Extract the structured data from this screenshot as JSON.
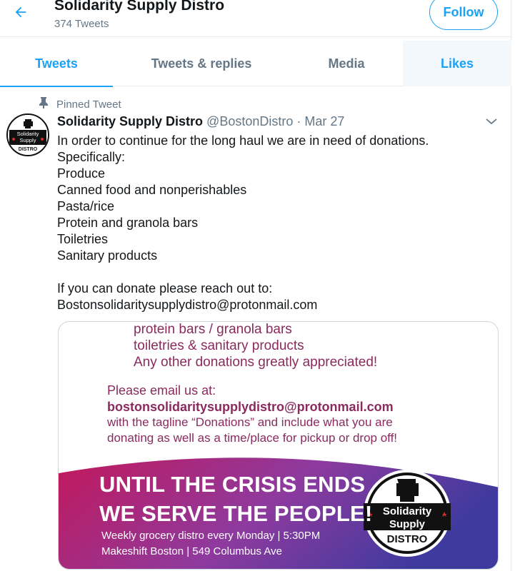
{
  "header": {
    "title": "Solidarity Supply Distro",
    "tweet_count": "374 Tweets",
    "follow_label": "Follow"
  },
  "tabs": [
    {
      "label": "Tweets"
    },
    {
      "label": "Tweets & replies"
    },
    {
      "label": "Media"
    },
    {
      "label": "Likes"
    }
  ],
  "tweet": {
    "pinned_label": "Pinned Tweet",
    "author_name": "Solidarity Supply Distro",
    "handle": "@BostonDistro",
    "separator": "·",
    "date": "Mar 27",
    "lines": [
      "In order to continue for the long haul we are in need of donations.",
      "Specifically:",
      "Produce",
      "Canned food and nonperishables",
      "Pasta/rice",
      "Protein and granola bars",
      "Toiletries",
      "Sanitary products",
      "",
      "If you can donate please reach out to:",
      "Bostonsolidaritysupplydistro@protonmail.com"
    ],
    "avatar_text": [
      "Solidarity",
      "Supply",
      "DISTRO"
    ]
  },
  "media": {
    "flyer_items": [
      "protein bars / granola bars",
      "toiletries & sanitary products",
      "Any other donations greatly appreciated!"
    ],
    "email_intro": "Please email us at:",
    "email": "bostonsolidaritysupplydistro@protonmail.com",
    "tagline_1": "with the tagline “Donations” and include what you are",
    "tagline_2": "donating as well as a time/place for pickup or drop off!",
    "banner_line_1": "UNTIL THE CRISIS ENDS",
    "banner_line_2": "WE SERVE THE PEOPLE!",
    "schedule_line_1": "Weekly grocery distro every Monday | 5:30PM",
    "schedule_line_2": "Makeshift Boston  | 549 Columbus Ave",
    "logo_text": [
      "Solidarity",
      "Supply",
      "DISTRO"
    ]
  },
  "colors": {
    "accent": "#1da1f2",
    "secondary_text": "#657786",
    "flyer_text": "#8a2a5e",
    "banner_start": "#c2185b",
    "banner_end": "#3f3a9e"
  }
}
